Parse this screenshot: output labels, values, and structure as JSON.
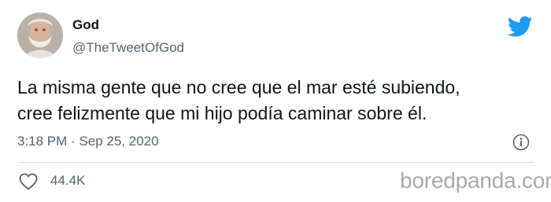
{
  "user": {
    "display_name": "God",
    "handle": "@TheTweetOfGod"
  },
  "tweet": {
    "text_lines": [
      "La misma gente que no cree que el mar esté subiendo,",
      "cree felizmente que mi hijo podía caminar sobre él."
    ],
    "timestamp": "3:18 PM · Sep 25, 2020"
  },
  "stats": {
    "likes": "44.4K"
  },
  "watermark": "boredpanda.com",
  "icons": {
    "brand": "twitter-bird-icon",
    "info": "info-icon",
    "like": "heart-icon"
  },
  "colors": {
    "twitter_blue": "#1d9bf0",
    "text_primary": "#0f1419",
    "text_secondary": "#536471",
    "divider": "#cfd9de",
    "watermark": "#a9a9a9"
  }
}
